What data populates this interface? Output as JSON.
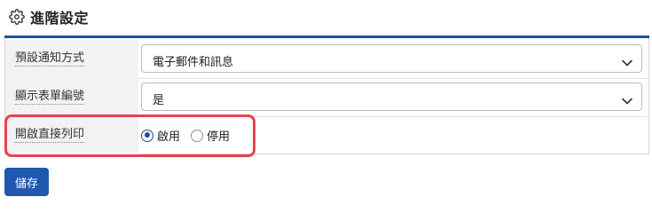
{
  "header": {
    "title": "進階設定",
    "icon": "gear-icon"
  },
  "settings": {
    "notification": {
      "label": "預設通知方式",
      "value": "電子郵件和訊息"
    },
    "show_form_number": {
      "label": "顯示表單編號",
      "value": "是"
    },
    "direct_print": {
      "label": "開啟直接列印",
      "options": [
        {
          "label": "啟用",
          "selected": true
        },
        {
          "label": "停用",
          "selected": false
        }
      ]
    }
  },
  "actions": {
    "save_label": "儲存"
  },
  "colors": {
    "accent": "#1f4e9c",
    "button": "#2058b0",
    "highlight": "#e6444e"
  }
}
